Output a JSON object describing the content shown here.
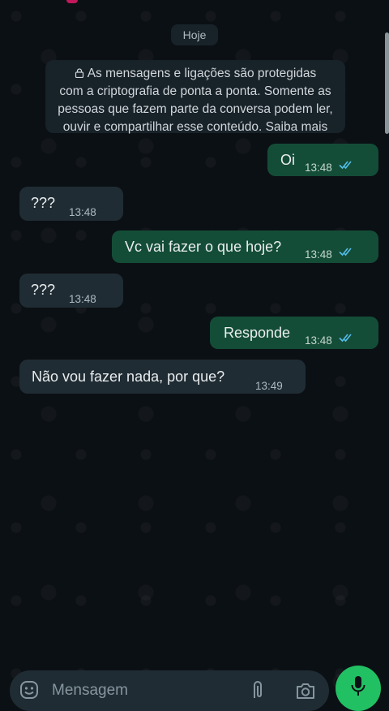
{
  "date_chip": "Hoje",
  "encryption_notice": {
    "lines": [
      "As mensagens e ligações são protegidas",
      "com a criptografia de ponta a ponta. Somente as",
      "pessoas que fazem parte da conversa podem ler,",
      "ouvir e compartilhar esse conteúdo. Saiba mais"
    ]
  },
  "messages": [
    {
      "direction": "outgoing",
      "text": "Oi",
      "time": "13:48",
      "status": "read"
    },
    {
      "direction": "incoming",
      "text": "???",
      "time": "13:48"
    },
    {
      "direction": "outgoing",
      "text": "Vc vai fazer o que hoje?",
      "time": "13:48",
      "status": "read"
    },
    {
      "direction": "incoming",
      "text": "???",
      "time": "13:48"
    },
    {
      "direction": "outgoing",
      "text": "Responde",
      "time": "13:48",
      "status": "read"
    },
    {
      "direction": "incoming",
      "text": "Não vou fazer nada, por que?",
      "time": "13:49"
    }
  ],
  "composer": {
    "placeholder": "Mensagem",
    "icons": [
      "emoji-icon",
      "attach-icon",
      "camera-icon",
      "mic-icon"
    ]
  },
  "colors": {
    "background": "#0b1014",
    "outgoing_bubble": "#144d37",
    "incoming_bubble": "#202c33",
    "read_ticks": "#53bdeb",
    "mic_button": "#21c063"
  }
}
